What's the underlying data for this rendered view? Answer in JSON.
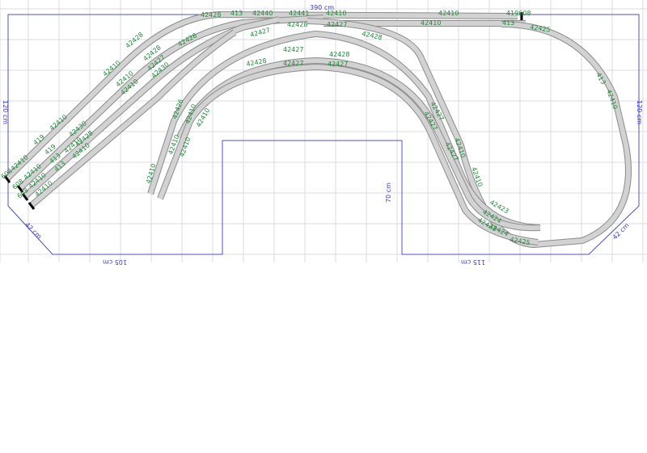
{
  "dimensions": {
    "top": "390 cm",
    "left": "120 cm",
    "right": "120 cm",
    "bottom_left": "105 cm",
    "bottom_right": "115 cm",
    "inner": "70 cm",
    "corner_left": "42 cm",
    "corner_right": "42 cm"
  },
  "track_labels": [
    "42428",
    "413",
    "42440",
    "42441",
    "42410",
    "42410",
    "419608",
    "42428",
    "42428",
    "42410",
    "42410",
    "42410",
    "42410",
    "42427",
    "42428",
    "42427",
    "42410",
    "42428",
    "413",
    "42425",
    "42427",
    "42428",
    "42427",
    "42428",
    "42427",
    "42428",
    "42427",
    "42430",
    "42430",
    "42428",
    "42426",
    "42410",
    "42410",
    "42410",
    "42410",
    "42410",
    "42410",
    "42410",
    "42410",
    "42410",
    "42410",
    "42410",
    "419",
    "419",
    "413",
    "413",
    "608",
    "608",
    "608",
    "42410",
    "42427",
    "42410",
    "42427",
    "42427",
    "42423",
    "42424",
    "42423",
    "42424",
    "42425",
    "413",
    "42410"
  ],
  "colors": {
    "outline": "#5050c8",
    "label": "#1f8a3a",
    "track": "#d2d2d2",
    "grid": "#d9dde6"
  }
}
